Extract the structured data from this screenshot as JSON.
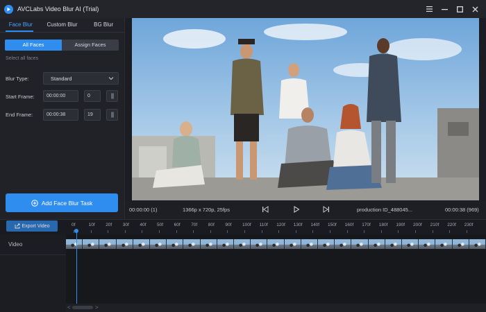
{
  "app": {
    "title": "AVCLabs Video Blur AI (Trial)"
  },
  "title_bar": {
    "menu_icon": "hamburger-icon",
    "minimize_icon": "minimize-icon",
    "maximize_icon": "maximize-icon",
    "close_icon": "close-icon"
  },
  "tabs": [
    {
      "label": "Face Blur",
      "active": true
    },
    {
      "label": "Custom Blur",
      "active": false
    },
    {
      "label": "BG Blur",
      "active": false
    }
  ],
  "face_mode": {
    "options": [
      {
        "label": "All Faces",
        "active": true
      },
      {
        "label": "Assign Faces",
        "active": false
      }
    ],
    "hint": "Select all faces"
  },
  "settings": {
    "blur_type_label": "Blur Type:",
    "blur_type_value": "Standard",
    "start_frame_label": "Start Frame:",
    "start_time": "00:00:00",
    "start_frame": "0",
    "end_frame_label": "End Frame:",
    "end_time": "00:00:38",
    "end_frame": "19"
  },
  "add_task_button": "Add Face Blur Task",
  "player": {
    "current_time": "00:00:00 (1)",
    "resolution": "1366p x 720p, 25fps",
    "file_name": "production ID_488045...",
    "total_time": "00:00:38 (969)"
  },
  "timeline": {
    "export_button": "Export Video",
    "ticks": [
      "0f",
      "10f",
      "20f",
      "30f",
      "40f",
      "50f",
      "60f",
      "70f",
      "80f",
      "90f",
      "100f",
      "110f",
      "120f",
      "130f",
      "140f",
      "150f",
      "160f",
      "170f",
      "180f",
      "190f",
      "200f",
      "210f",
      "220f",
      "230f"
    ],
    "track_label": "Video",
    "scroll_left": "<",
    "scroll_right": ">"
  },
  "colors": {
    "accent": "#2f8df0",
    "background": "#1b1d22",
    "panel": "#202228"
  }
}
